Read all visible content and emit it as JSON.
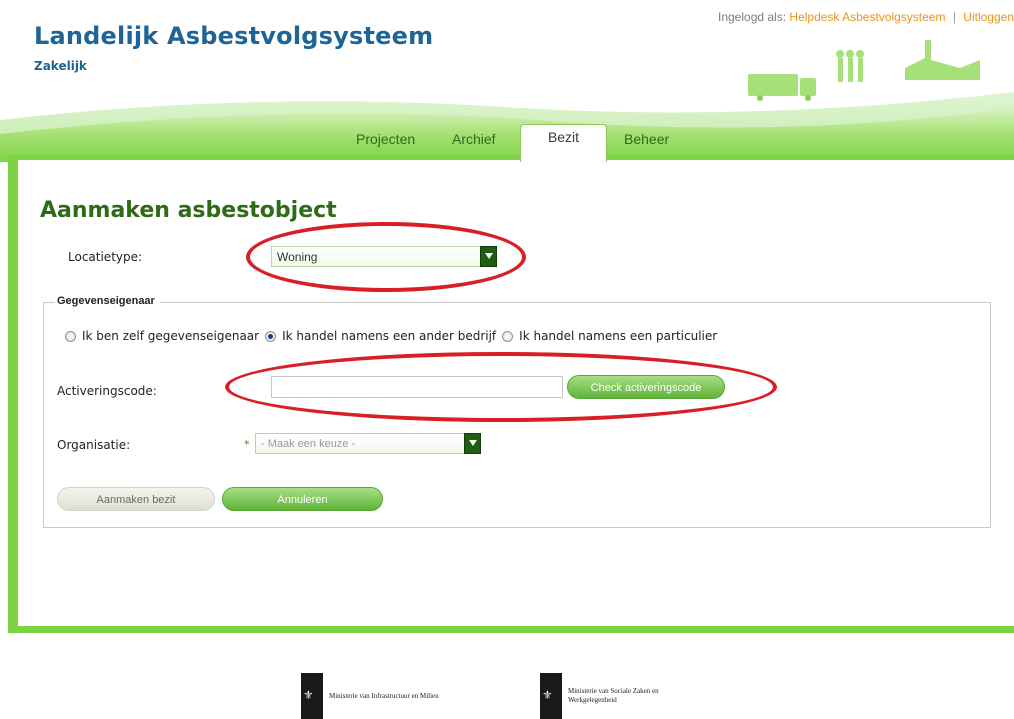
{
  "header": {
    "title": "Landelijk Asbestvolgsysteem",
    "subtitle": "Zakelijk",
    "logged_in_prefix": "Ingelogd als:",
    "user": "Helpdesk Asbestvolgsysteem",
    "separator": "|",
    "logout": "Uitloggen"
  },
  "nav": {
    "tabs": [
      {
        "label": "Projecten"
      },
      {
        "label": "Archief"
      },
      {
        "label": "Bezit",
        "active": true
      },
      {
        "label": "Beheer"
      }
    ]
  },
  "form": {
    "title": "Aanmaken asbestobject",
    "locatietype": {
      "label": "Locatietype:",
      "value": "Woning"
    },
    "owner_section": {
      "legend": "Gegevenseigenaar",
      "options": [
        {
          "label": "Ik ben zelf gegevenseigenaar",
          "checked": false
        },
        {
          "label": "Ik handel namens een ander bedrijf",
          "checked": true
        },
        {
          "label": "Ik handel namens een particulier",
          "checked": false
        }
      ]
    },
    "activeringscode": {
      "label": "Activeringscode:",
      "value": "",
      "button": "Check activeringscode"
    },
    "organisatie": {
      "label": "Organisatie:",
      "required_mark": "*",
      "placeholder": "- Maak een keuze -"
    },
    "buttons": {
      "create": "Aanmaken bezit",
      "cancel": "Annuleren"
    }
  },
  "footer": {
    "ministries": [
      {
        "name": "Ministerie van Infrastructuur en Milieu"
      },
      {
        "name_line1": "Ministerie van Sociale Zaken en",
        "name_line2": "Werkgelegenheid"
      }
    ]
  },
  "colors": {
    "title_blue": "#1f6496",
    "heading_green": "#2f6a14",
    "accent_orange": "#e8951a",
    "frame_green": "#7ed344",
    "annotation_red": "#d81f26"
  }
}
